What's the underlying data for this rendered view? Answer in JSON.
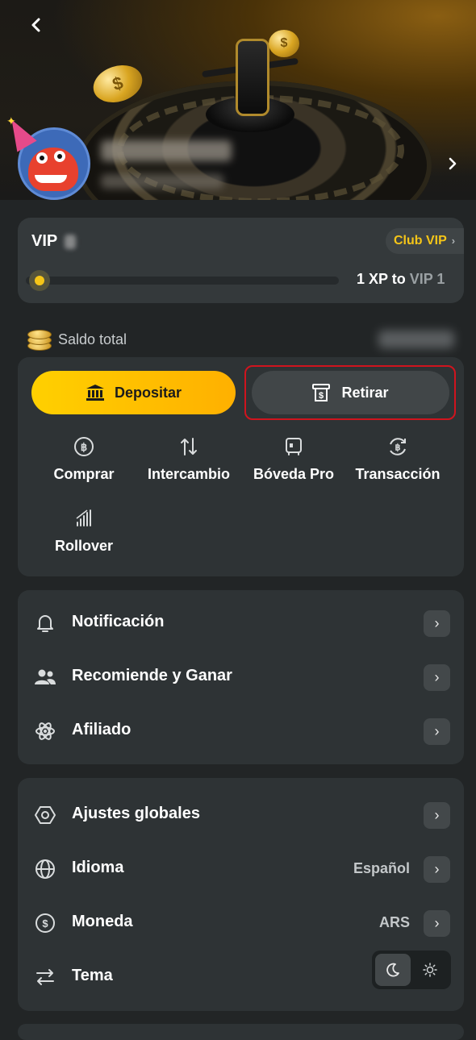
{
  "vip": {
    "label": "VIP",
    "club_label": "Club VIP",
    "progress_fraction": 0.0,
    "xp_text": "1 XP to",
    "next_level": "VIP 1"
  },
  "balance": {
    "label": "Saldo total"
  },
  "wallet": {
    "deposit_label": "Depositar",
    "withdraw_label": "Retirar",
    "actions": [
      {
        "label": "Comprar",
        "icon": "bitcoin-icon"
      },
      {
        "label": "Intercambio",
        "icon": "swap-arrows-icon"
      },
      {
        "label": "Bóveda Pro",
        "icon": "vault-icon"
      },
      {
        "label": "Transacción",
        "icon": "transaction-icon"
      },
      {
        "label": "Rollover",
        "icon": "bar-chart-icon"
      }
    ]
  },
  "menu1": {
    "items": [
      {
        "label": "Notificación",
        "icon": "bell-icon"
      },
      {
        "label": "Recomiende y Ganar",
        "icon": "users-icon"
      },
      {
        "label": "Afiliado",
        "icon": "atom-icon"
      }
    ]
  },
  "menu2": {
    "items": [
      {
        "label": "Ajustes globales",
        "icon": "hexagon-settings-icon",
        "value": ""
      },
      {
        "label": "Idioma",
        "icon": "globe-icon",
        "value": "Español"
      },
      {
        "label": "Moneda",
        "icon": "dollar-circle-icon",
        "value": "ARS"
      },
      {
        "label": "Tema",
        "icon": "swap-horizontal-icon",
        "value": ""
      }
    ]
  },
  "colors": {
    "accent_yellow": "#f5c518",
    "highlight_red": "#d0141e",
    "card_bg": "#2e3335",
    "page_bg": "#222526"
  }
}
